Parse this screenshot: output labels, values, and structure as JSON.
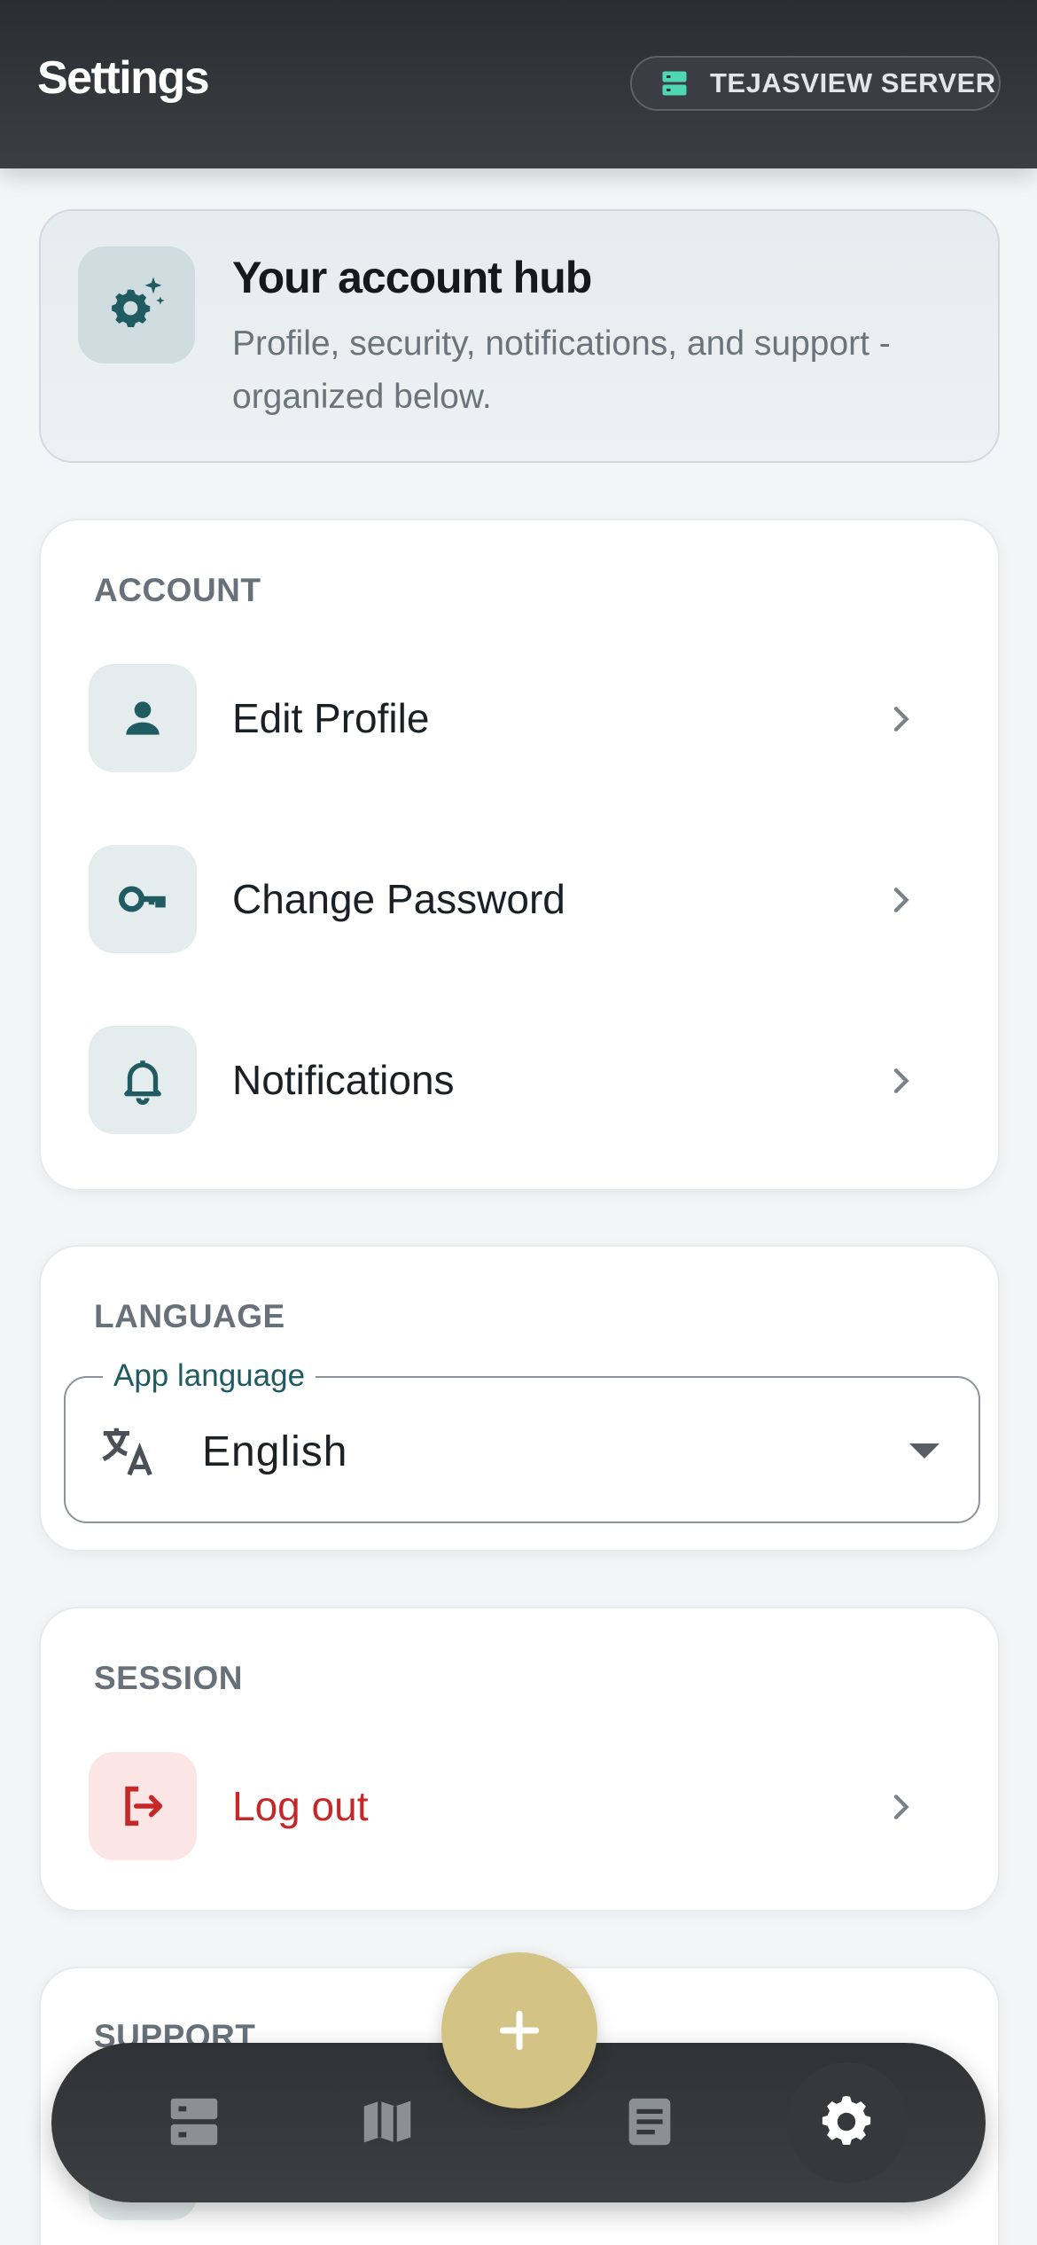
{
  "header": {
    "title": "Settings",
    "server_label": "TEJASVIEW SERVER",
    "server_icon": "server-icon"
  },
  "hub": {
    "icon": "settings-sparkle-icon",
    "title": "Your account hub",
    "subtitle": "Profile, security, notifications, and support - organized below."
  },
  "account": {
    "label": "ACCOUNT",
    "items": [
      {
        "label": "Edit Profile",
        "icon": "person-icon"
      },
      {
        "label": "Change Password",
        "icon": "key-icon"
      },
      {
        "label": "Notifications",
        "icon": "bell-icon"
      }
    ]
  },
  "language": {
    "label": "LANGUAGE",
    "field_label": "App language",
    "value": "English",
    "icon": "translate-icon"
  },
  "session": {
    "label": "SESSION",
    "logout_label": "Log out",
    "icon": "logout-icon"
  },
  "support": {
    "label": "SUPPORT"
  },
  "bottom_nav": {
    "items": [
      "server-icon",
      "map-icon",
      "article-icon",
      "settings-icon"
    ],
    "active": "settings-icon",
    "fab_icon": "plus-icon"
  },
  "colors": {
    "header_bg": "#2a2e31",
    "accent": "#215b62",
    "danger": "#c62828",
    "fab": "#d3c384",
    "server_icon": "#4fd6b3"
  }
}
